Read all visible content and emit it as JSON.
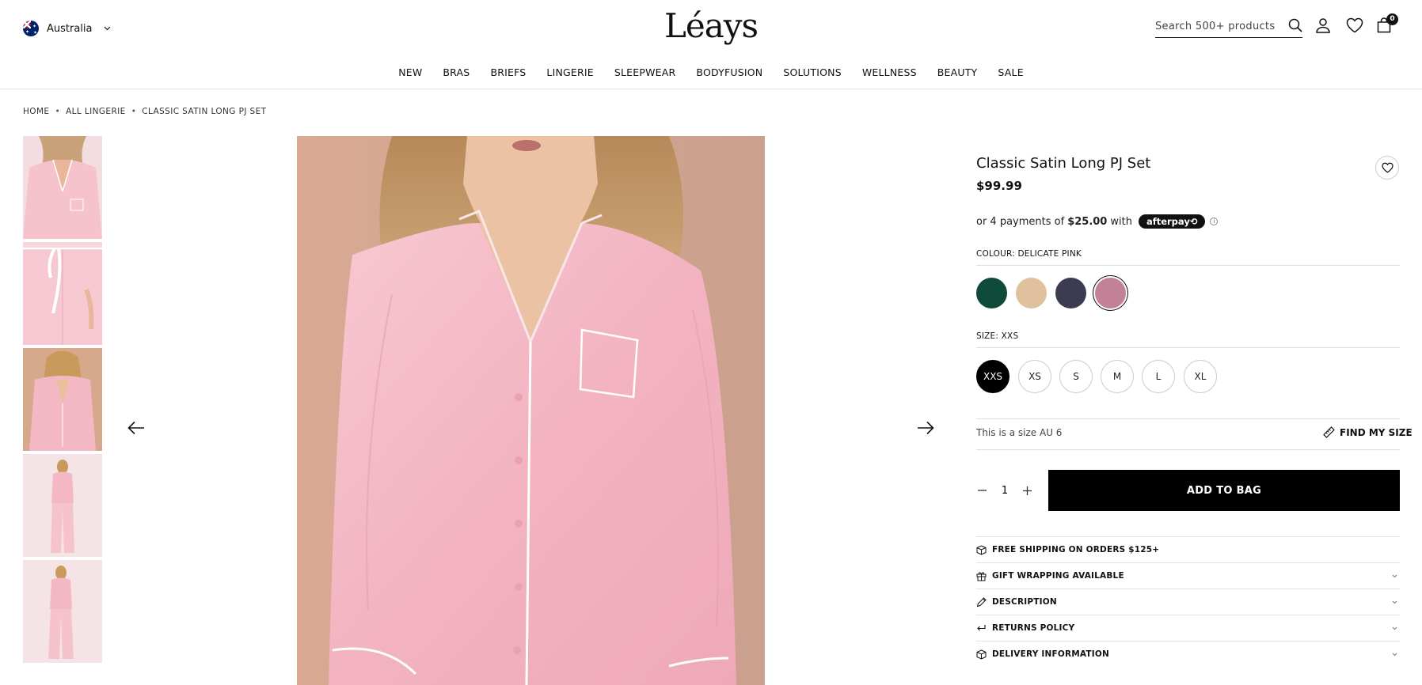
{
  "header": {
    "country": "Australia",
    "logo": "Léays",
    "search_placeholder": "Search 500+ products",
    "bag_count": "0"
  },
  "nav": {
    "items": [
      "NEW",
      "BRAS",
      "BRIEFS",
      "LINGERIE",
      "SLEEPWEAR",
      "BODYFUSION",
      "SOLUTIONS",
      "WELLNESS",
      "BEAUTY",
      "SALE"
    ]
  },
  "breadcrumb": {
    "items": [
      "HOME",
      "ALL LINGERIE",
      "CLASSIC SATIN LONG PJ SET"
    ],
    "separator": "•"
  },
  "product": {
    "title": "Classic Satin Long PJ Set",
    "price": "$99.99",
    "installment_prefix": "or 4 payments of",
    "installment_amount": "$25.00",
    "installment_with": "with",
    "afterpay_label": "afterpay⟲",
    "colour_label": "COLOUR: DELICATE PINK",
    "colours": [
      "#0f4a3a",
      "#dfc19d",
      "#3b3b52",
      "#c28196"
    ],
    "selected_colour_index": 3,
    "size_label": "SIZE: XXS",
    "sizes": [
      "XXS",
      "XS",
      "S",
      "M",
      "L",
      "XL"
    ],
    "selected_size": "XXS",
    "size_note": "This is a size AU 6",
    "find_my_size": "FIND MY SIZE",
    "quantity": "1",
    "add_to_bag": "ADD TO BAG"
  },
  "accordion": [
    {
      "label": "FREE SHIPPING ON ORDERS $125+",
      "icon": "box-icon",
      "expandable": false
    },
    {
      "label": "GIFT WRAPPING AVAILABLE",
      "icon": "gift-icon",
      "expandable": true
    },
    {
      "label": "DESCRIPTION",
      "icon": "pencil-icon",
      "expandable": true
    },
    {
      "label": "RETURNS POLICY",
      "icon": "return-arrow-icon",
      "expandable": true
    },
    {
      "label": "DELIVERY INFORMATION",
      "icon": "box-icon",
      "expandable": true
    }
  ],
  "colors": {
    "pink_satin": "#f4b8c4",
    "black": "#000000"
  }
}
